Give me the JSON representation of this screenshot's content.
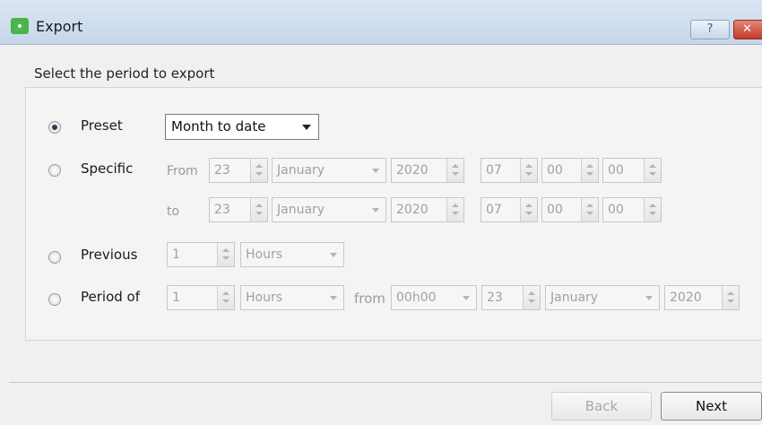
{
  "window": {
    "title": "Export",
    "help_label": "?",
    "close_label": "✕"
  },
  "heading": "Select the period to export",
  "options": {
    "preset": {
      "label": "Preset",
      "selected": true,
      "value": "Month to date"
    },
    "specific": {
      "label": "Specific",
      "from_label": "From",
      "to_label": "to",
      "from": {
        "day": "23",
        "month": "January",
        "year": "2020",
        "hour": "07",
        "minute": "00",
        "second": "00"
      },
      "to": {
        "day": "23",
        "month": "January",
        "year": "2020",
        "hour": "07",
        "minute": "00",
        "second": "00"
      }
    },
    "previous": {
      "label": "Previous",
      "count": "1",
      "unit": "Hours"
    },
    "period_of": {
      "label": "Period of",
      "count": "1",
      "unit": "Hours",
      "from_label": "from",
      "time": "00h00",
      "day": "23",
      "month": "January",
      "year": "2020"
    }
  },
  "buttons": {
    "back": "Back",
    "next": "Next"
  }
}
